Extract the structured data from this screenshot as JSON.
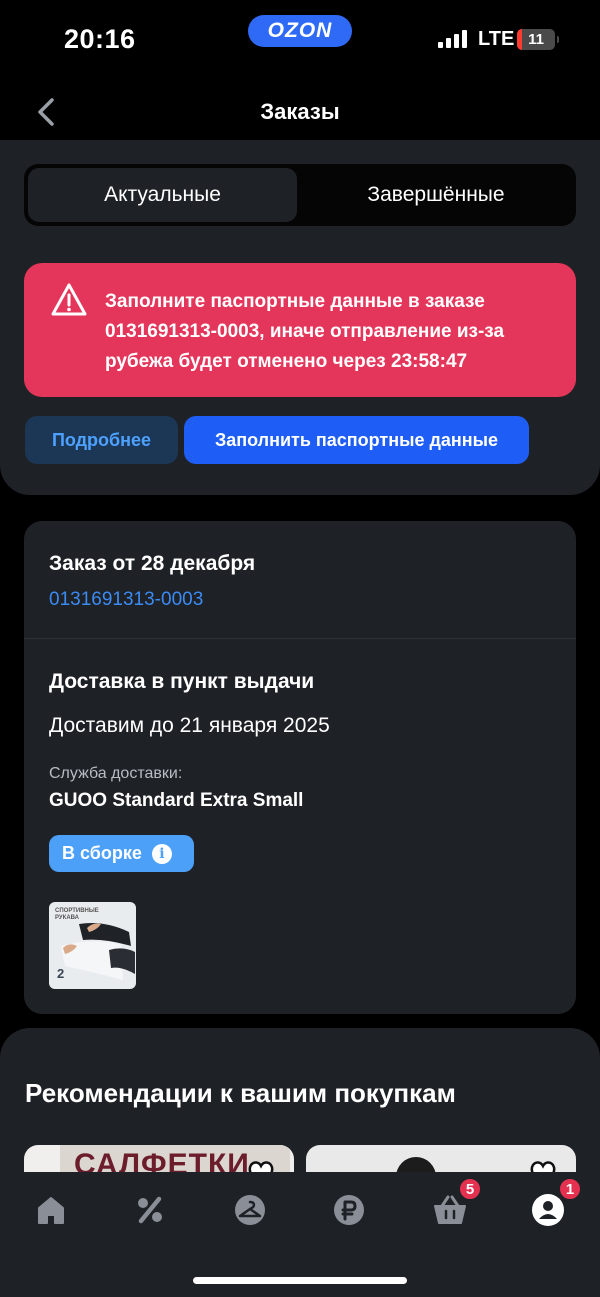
{
  "status_bar": {
    "time": "20:16",
    "brand": "OZON",
    "network": "LTE",
    "battery": "11"
  },
  "header": {
    "title": "Заказы"
  },
  "tabs": {
    "active": "Актуальные",
    "inactive": "Завершённые"
  },
  "alert": {
    "text": "Заполните паспортные данные в заказе 0131691313-0003, иначе отправление из-за рубежа будет отменено через 23:58:47",
    "more_label": "Подробнее",
    "fill_label": "Заполнить паспортные данные"
  },
  "order": {
    "title": "Заказ от 28 декабря",
    "number": "0131691313-0003",
    "delivery_type": "Доставка в пункт выдачи",
    "delivery_date": "Доставим до 21 января 2025",
    "service_label": "Служба доставки:",
    "service_name": "GUOO Standard Extra Small",
    "status": "В сборке",
    "product_caption": "СПОРТИВНЫЕ РУКАВА",
    "product_count": "2"
  },
  "recommendations": {
    "title": "Рекомендации к вашим покупкам",
    "card1_text": "САЛФЕТКИ"
  },
  "tabbar": {
    "cart_badge": "5",
    "profile_badge": "1"
  },
  "colors": {
    "accent_blue": "#1e5ef6",
    "alert_red": "#e4365a",
    "link_blue": "#3b8bf5",
    "status_blue": "#4ca0f7",
    "badge_red": "#e3314f"
  }
}
